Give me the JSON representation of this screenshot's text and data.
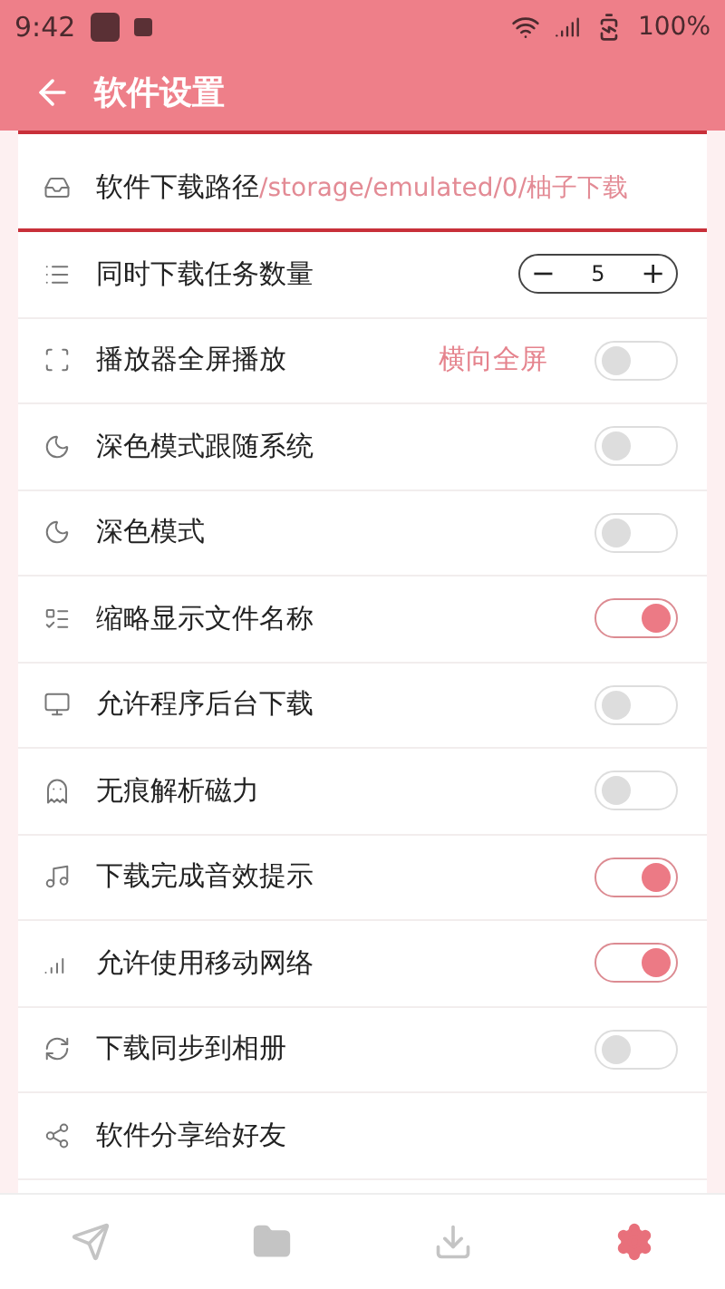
{
  "status_bar": {
    "time": "9:42",
    "battery": "100%"
  },
  "app_bar": {
    "title": "软件设置"
  },
  "rows": [
    {
      "kind": "path",
      "label": "软件下载路径",
      "value": "/storage/emulated/0/柚子下载",
      "highlighted": true
    },
    {
      "kind": "stepper",
      "label": "同时下载任务数量",
      "minus": "−",
      "value": "5",
      "plus": "+"
    },
    {
      "kind": "toggle",
      "label": "播放器全屏播放",
      "hint": "横向全屏",
      "on": false
    },
    {
      "kind": "toggle",
      "label": "深色模式跟随系统",
      "on": false
    },
    {
      "kind": "toggle",
      "label": "深色模式",
      "on": false
    },
    {
      "kind": "toggle",
      "label": "缩略显示文件名称",
      "on": true
    },
    {
      "kind": "toggle",
      "label": "允许程序后台下载",
      "on": false
    },
    {
      "kind": "toggle",
      "label": "无痕解析磁力",
      "on": false
    },
    {
      "kind": "toggle",
      "label": "下载完成音效提示",
      "on": true
    },
    {
      "kind": "toggle",
      "label": "允许使用移动网络",
      "on": true
    },
    {
      "kind": "toggle",
      "label": "下载同步到相册",
      "on": false
    },
    {
      "kind": "link",
      "label": "软件分享给好友"
    }
  ],
  "bottom_nav": [
    {
      "selected": false
    },
    {
      "selected": false
    },
    {
      "selected": false
    },
    {
      "selected": true
    }
  ]
}
